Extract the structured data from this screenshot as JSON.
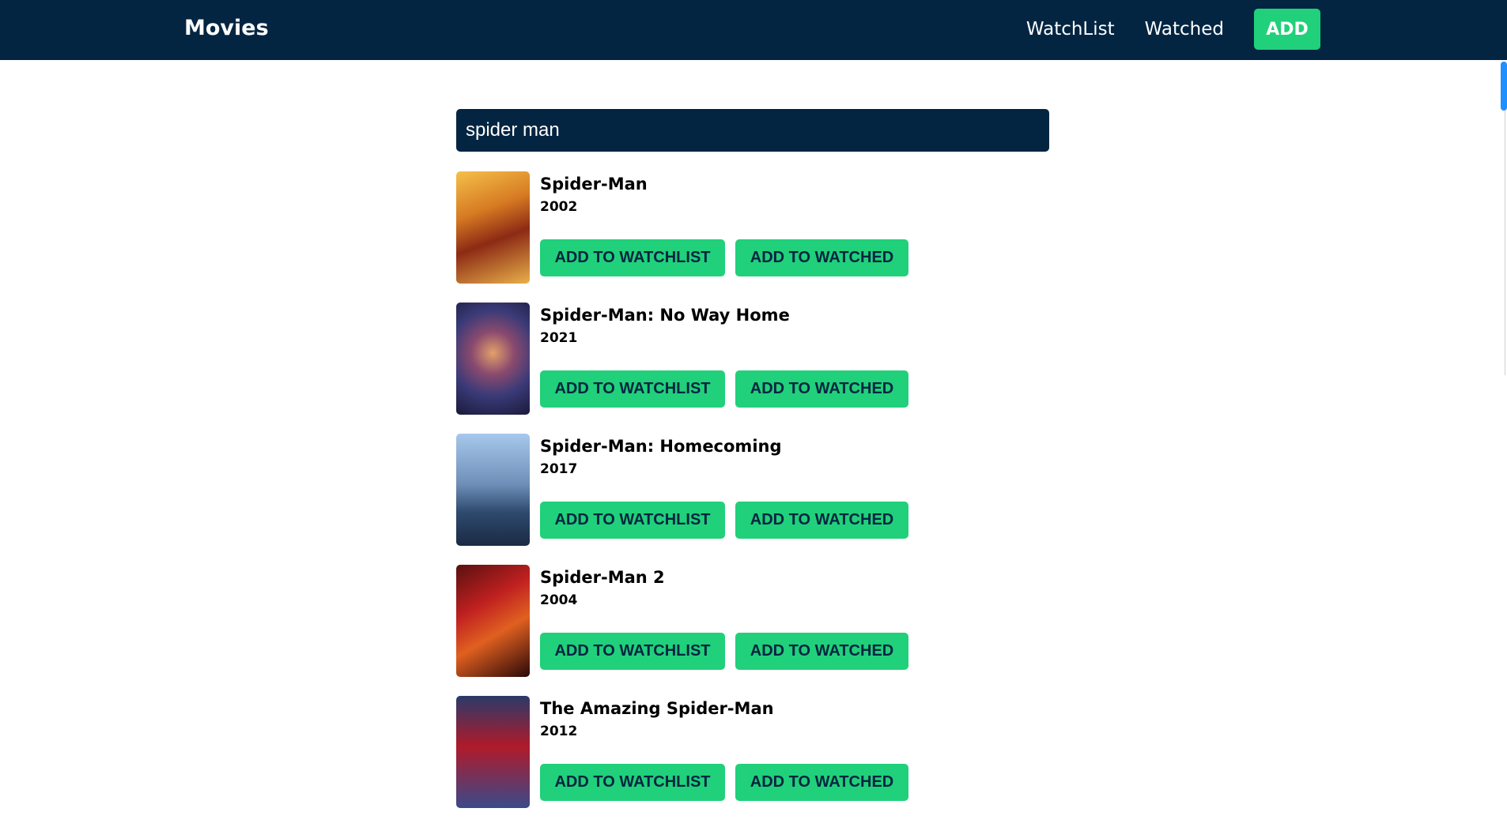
{
  "nav": {
    "brand": "Movies",
    "watchlist_label": "WatchList",
    "watched_label": "Watched",
    "add_label": "ADD"
  },
  "search": {
    "value": "spider man"
  },
  "results": [
    {
      "title": "Spider-Man",
      "year": "2002",
      "watchlist_label": "ADD TO WATCHLIST",
      "watched_label": "ADD TO WATCHED"
    },
    {
      "title": "Spider-Man: No Way Home",
      "year": "2021",
      "watchlist_label": "ADD TO WATCHLIST",
      "watched_label": "ADD TO WATCHED"
    },
    {
      "title": "Spider-Man: Homecoming",
      "year": "2017",
      "watchlist_label": "ADD TO WATCHLIST",
      "watched_label": "ADD TO WATCHED"
    },
    {
      "title": "Spider-Man 2",
      "year": "2004",
      "watchlist_label": "ADD TO WATCHLIST",
      "watched_label": "ADD TO WATCHED"
    },
    {
      "title": "The Amazing Spider-Man",
      "year": "2012",
      "watchlist_label": "ADD TO WATCHLIST",
      "watched_label": "ADD TO WATCHED"
    }
  ],
  "colors": {
    "navbar_bg": "#032541",
    "accent_green": "#21d07a",
    "scrollbar_thumb": "#1e90ff"
  }
}
